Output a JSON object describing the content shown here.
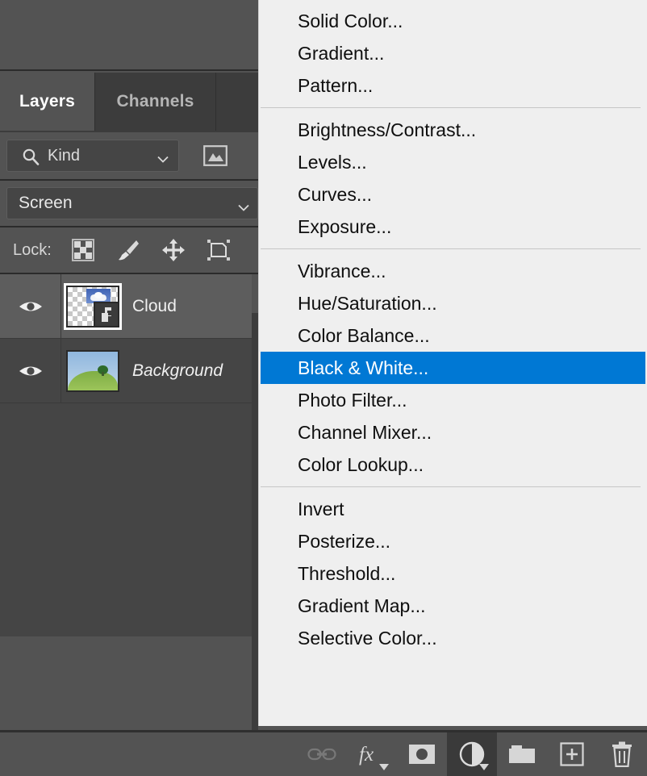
{
  "panel": {
    "tabs": [
      {
        "label": "Layers",
        "active": true
      },
      {
        "label": "Channels",
        "active": false
      }
    ],
    "filter": {
      "kind_label": "Kind",
      "search_icon": "search-icon",
      "image_filter_icon": "image-icon"
    },
    "blend_mode": "Screen",
    "lock": {
      "label": "Lock:",
      "icons": [
        "transparency-checkerboard-icon",
        "brush-icon",
        "move-arrows-icon",
        "artboard-icon"
      ]
    },
    "layers": [
      {
        "name": "Cloud",
        "visible": true,
        "selected": true,
        "italic": false,
        "thumb": "transparent-cloud-smart-object"
      },
      {
        "name": "Background",
        "visible": true,
        "selected": false,
        "italic": true,
        "thumb": "landscape-tree-field"
      }
    ],
    "footer_buttons": [
      {
        "name": "link-layers-icon",
        "label": "Link layers",
        "active": false,
        "disabled": true
      },
      {
        "name": "fx-icon",
        "label": "Add a layer style",
        "active": false,
        "disabled": false
      },
      {
        "name": "layer-mask-icon",
        "label": "Add layer mask",
        "active": false,
        "disabled": false
      },
      {
        "name": "adjustment-layer-icon",
        "label": "Create new fill or adjustment layer",
        "active": true,
        "disabled": false
      },
      {
        "name": "folder-icon",
        "label": "Create a new group",
        "active": false,
        "disabled": false
      },
      {
        "name": "new-layer-icon",
        "label": "Create a new layer",
        "active": false,
        "disabled": false
      },
      {
        "name": "trash-icon",
        "label": "Delete layer",
        "active": false,
        "disabled": false
      }
    ]
  },
  "menu": {
    "highlight_color": "#0078d4",
    "background_color": "#efefef",
    "groups": [
      {
        "items": [
          {
            "label": "Solid Color...",
            "highlighted": false
          },
          {
            "label": "Gradient...",
            "highlighted": false
          },
          {
            "label": "Pattern...",
            "highlighted": false
          }
        ]
      },
      {
        "items": [
          {
            "label": "Brightness/Contrast...",
            "highlighted": false
          },
          {
            "label": "Levels...",
            "highlighted": false
          },
          {
            "label": "Curves...",
            "highlighted": false
          },
          {
            "label": "Exposure...",
            "highlighted": false
          }
        ]
      },
      {
        "items": [
          {
            "label": "Vibrance...",
            "highlighted": false
          },
          {
            "label": "Hue/Saturation...",
            "highlighted": false
          },
          {
            "label": "Color Balance...",
            "highlighted": false
          },
          {
            "label": "Black & White...",
            "highlighted": true
          },
          {
            "label": "Photo Filter...",
            "highlighted": false
          },
          {
            "label": "Channel Mixer...",
            "highlighted": false
          },
          {
            "label": "Color Lookup...",
            "highlighted": false
          }
        ]
      },
      {
        "items": [
          {
            "label": "Invert",
            "highlighted": false
          },
          {
            "label": "Posterize...",
            "highlighted": false
          },
          {
            "label": "Threshold...",
            "highlighted": false
          },
          {
            "label": "Gradient Map...",
            "highlighted": false
          },
          {
            "label": "Selective Color...",
            "highlighted": false
          }
        ]
      }
    ]
  }
}
